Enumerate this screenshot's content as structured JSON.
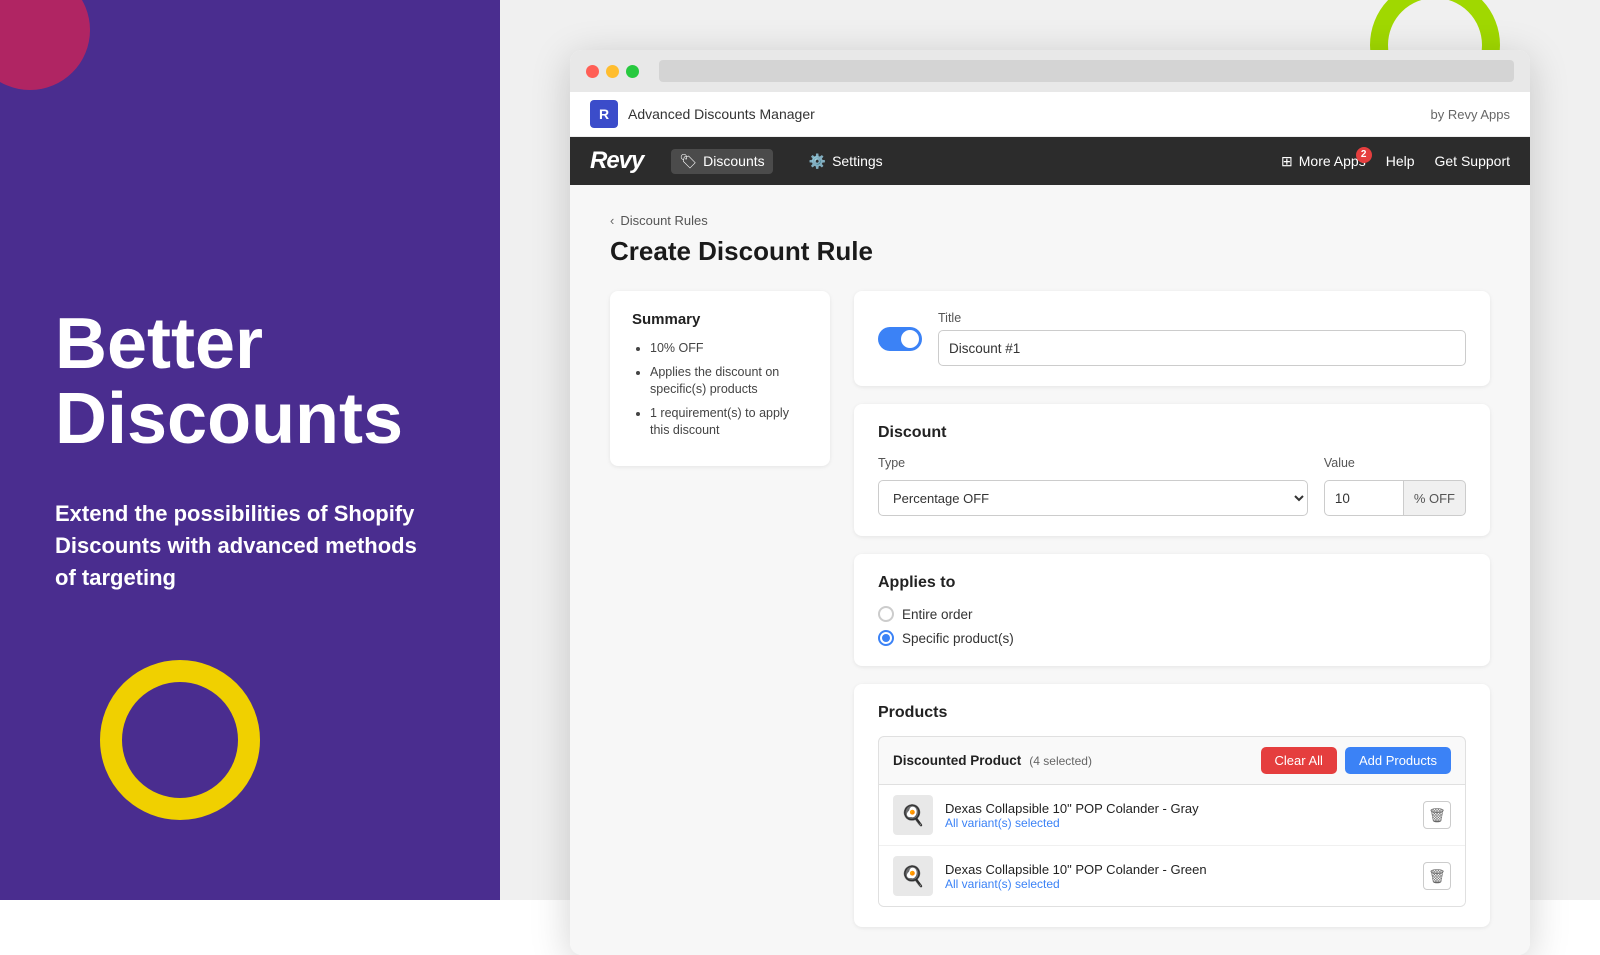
{
  "left": {
    "hero_title": "Better Discounts",
    "hero_subtitle": "Extend the possibilities of Shopify Discounts with advanced methods of targeting"
  },
  "browser": {
    "app_name": "Advanced Discounts Manager",
    "by_revy": "by Revy Apps"
  },
  "nav": {
    "logo": "Revy",
    "discounts_label": "Discounts",
    "settings_label": "Settings",
    "more_apps_label": "More Apps",
    "more_apps_badge": "2",
    "help_label": "Help",
    "support_label": "Get Support"
  },
  "page": {
    "breadcrumb": "Discount Rules",
    "title": "Create Discount Rule"
  },
  "summary": {
    "title": "Summary",
    "items": [
      "10% OFF",
      "Applies the discount on specific(s) products",
      "1 requirement(s) to apply this discount"
    ]
  },
  "form": {
    "title_label": "Title",
    "title_value": "Discount #1",
    "discount_section": "Discount",
    "type_label": "Type",
    "type_value": "Percentage OFF",
    "value_label": "Value",
    "value_number": "10",
    "value_suffix": "% OFF",
    "applies_to_label": "Applies to",
    "radio_entire": "Entire order",
    "radio_specific": "Specific product(s)",
    "products_label": "Products",
    "discounted_label": "Discounted Product",
    "selected_count": "(4 selected)",
    "clear_all_label": "Clear All",
    "add_products_label": "Add Products",
    "products": [
      {
        "name": "Dexas Collapsible 10\" POP Colander - Gray",
        "variant": "All variant(s) selected",
        "icon": "🫙"
      },
      {
        "name": "Dexas Collapsible 10\" POP Colander - Green",
        "variant": "All variant(s) selected",
        "icon": "🫙"
      }
    ]
  }
}
